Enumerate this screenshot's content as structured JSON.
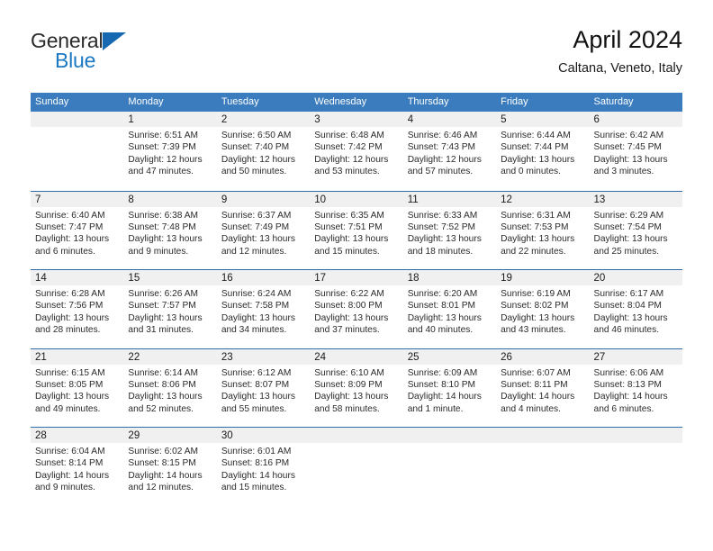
{
  "brand": {
    "name_part1": "General",
    "name_part2": "Blue"
  },
  "header": {
    "month_title": "April 2024",
    "location": "Caltana, Veneto, Italy"
  },
  "colors": {
    "header_blue": "#3a7cbe",
    "week_divider": "#2f6ea8",
    "daynum_band": "#f0f0f0",
    "brand_blue": "#1b79c4"
  },
  "weekdays": [
    "Sunday",
    "Monday",
    "Tuesday",
    "Wednesday",
    "Thursday",
    "Friday",
    "Saturday"
  ],
  "weeks": [
    [
      {
        "day": "",
        "sunrise": "",
        "sunset": "",
        "daylight_line1": "",
        "daylight_line2": "",
        "empty": true
      },
      {
        "day": "1",
        "sunrise": "Sunrise: 6:51 AM",
        "sunset": "Sunset: 7:39 PM",
        "daylight_line1": "Daylight: 12 hours",
        "daylight_line2": "and 47 minutes."
      },
      {
        "day": "2",
        "sunrise": "Sunrise: 6:50 AM",
        "sunset": "Sunset: 7:40 PM",
        "daylight_line1": "Daylight: 12 hours",
        "daylight_line2": "and 50 minutes."
      },
      {
        "day": "3",
        "sunrise": "Sunrise: 6:48 AM",
        "sunset": "Sunset: 7:42 PM",
        "daylight_line1": "Daylight: 12 hours",
        "daylight_line2": "and 53 minutes."
      },
      {
        "day": "4",
        "sunrise": "Sunrise: 6:46 AM",
        "sunset": "Sunset: 7:43 PM",
        "daylight_line1": "Daylight: 12 hours",
        "daylight_line2": "and 57 minutes."
      },
      {
        "day": "5",
        "sunrise": "Sunrise: 6:44 AM",
        "sunset": "Sunset: 7:44 PM",
        "daylight_line1": "Daylight: 13 hours",
        "daylight_line2": "and 0 minutes."
      },
      {
        "day": "6",
        "sunrise": "Sunrise: 6:42 AM",
        "sunset": "Sunset: 7:45 PM",
        "daylight_line1": "Daylight: 13 hours",
        "daylight_line2": "and 3 minutes."
      }
    ],
    [
      {
        "day": "7",
        "sunrise": "Sunrise: 6:40 AM",
        "sunset": "Sunset: 7:47 PM",
        "daylight_line1": "Daylight: 13 hours",
        "daylight_line2": "and 6 minutes."
      },
      {
        "day": "8",
        "sunrise": "Sunrise: 6:38 AM",
        "sunset": "Sunset: 7:48 PM",
        "daylight_line1": "Daylight: 13 hours",
        "daylight_line2": "and 9 minutes."
      },
      {
        "day": "9",
        "sunrise": "Sunrise: 6:37 AM",
        "sunset": "Sunset: 7:49 PM",
        "daylight_line1": "Daylight: 13 hours",
        "daylight_line2": "and 12 minutes."
      },
      {
        "day": "10",
        "sunrise": "Sunrise: 6:35 AM",
        "sunset": "Sunset: 7:51 PM",
        "daylight_line1": "Daylight: 13 hours",
        "daylight_line2": "and 15 minutes."
      },
      {
        "day": "11",
        "sunrise": "Sunrise: 6:33 AM",
        "sunset": "Sunset: 7:52 PM",
        "daylight_line1": "Daylight: 13 hours",
        "daylight_line2": "and 18 minutes."
      },
      {
        "day": "12",
        "sunrise": "Sunrise: 6:31 AM",
        "sunset": "Sunset: 7:53 PM",
        "daylight_line1": "Daylight: 13 hours",
        "daylight_line2": "and 22 minutes."
      },
      {
        "day": "13",
        "sunrise": "Sunrise: 6:29 AM",
        "sunset": "Sunset: 7:54 PM",
        "daylight_line1": "Daylight: 13 hours",
        "daylight_line2": "and 25 minutes."
      }
    ],
    [
      {
        "day": "14",
        "sunrise": "Sunrise: 6:28 AM",
        "sunset": "Sunset: 7:56 PM",
        "daylight_line1": "Daylight: 13 hours",
        "daylight_line2": "and 28 minutes."
      },
      {
        "day": "15",
        "sunrise": "Sunrise: 6:26 AM",
        "sunset": "Sunset: 7:57 PM",
        "daylight_line1": "Daylight: 13 hours",
        "daylight_line2": "and 31 minutes."
      },
      {
        "day": "16",
        "sunrise": "Sunrise: 6:24 AM",
        "sunset": "Sunset: 7:58 PM",
        "daylight_line1": "Daylight: 13 hours",
        "daylight_line2": "and 34 minutes."
      },
      {
        "day": "17",
        "sunrise": "Sunrise: 6:22 AM",
        "sunset": "Sunset: 8:00 PM",
        "daylight_line1": "Daylight: 13 hours",
        "daylight_line2": "and 37 minutes."
      },
      {
        "day": "18",
        "sunrise": "Sunrise: 6:20 AM",
        "sunset": "Sunset: 8:01 PM",
        "daylight_line1": "Daylight: 13 hours",
        "daylight_line2": "and 40 minutes."
      },
      {
        "day": "19",
        "sunrise": "Sunrise: 6:19 AM",
        "sunset": "Sunset: 8:02 PM",
        "daylight_line1": "Daylight: 13 hours",
        "daylight_line2": "and 43 minutes."
      },
      {
        "day": "20",
        "sunrise": "Sunrise: 6:17 AM",
        "sunset": "Sunset: 8:04 PM",
        "daylight_line1": "Daylight: 13 hours",
        "daylight_line2": "and 46 minutes."
      }
    ],
    [
      {
        "day": "21",
        "sunrise": "Sunrise: 6:15 AM",
        "sunset": "Sunset: 8:05 PM",
        "daylight_line1": "Daylight: 13 hours",
        "daylight_line2": "and 49 minutes."
      },
      {
        "day": "22",
        "sunrise": "Sunrise: 6:14 AM",
        "sunset": "Sunset: 8:06 PM",
        "daylight_line1": "Daylight: 13 hours",
        "daylight_line2": "and 52 minutes."
      },
      {
        "day": "23",
        "sunrise": "Sunrise: 6:12 AM",
        "sunset": "Sunset: 8:07 PM",
        "daylight_line1": "Daylight: 13 hours",
        "daylight_line2": "and 55 minutes."
      },
      {
        "day": "24",
        "sunrise": "Sunrise: 6:10 AM",
        "sunset": "Sunset: 8:09 PM",
        "daylight_line1": "Daylight: 13 hours",
        "daylight_line2": "and 58 minutes."
      },
      {
        "day": "25",
        "sunrise": "Sunrise: 6:09 AM",
        "sunset": "Sunset: 8:10 PM",
        "daylight_line1": "Daylight: 14 hours",
        "daylight_line2": "and 1 minute."
      },
      {
        "day": "26",
        "sunrise": "Sunrise: 6:07 AM",
        "sunset": "Sunset: 8:11 PM",
        "daylight_line1": "Daylight: 14 hours",
        "daylight_line2": "and 4 minutes."
      },
      {
        "day": "27",
        "sunrise": "Sunrise: 6:06 AM",
        "sunset": "Sunset: 8:13 PM",
        "daylight_line1": "Daylight: 14 hours",
        "daylight_line2": "and 6 minutes."
      }
    ],
    [
      {
        "day": "28",
        "sunrise": "Sunrise: 6:04 AM",
        "sunset": "Sunset: 8:14 PM",
        "daylight_line1": "Daylight: 14 hours",
        "daylight_line2": "and 9 minutes."
      },
      {
        "day": "29",
        "sunrise": "Sunrise: 6:02 AM",
        "sunset": "Sunset: 8:15 PM",
        "daylight_line1": "Daylight: 14 hours",
        "daylight_line2": "and 12 minutes."
      },
      {
        "day": "30",
        "sunrise": "Sunrise: 6:01 AM",
        "sunset": "Sunset: 8:16 PM",
        "daylight_line1": "Daylight: 14 hours",
        "daylight_line2": "and 15 minutes."
      },
      {
        "day": "",
        "sunrise": "",
        "sunset": "",
        "daylight_line1": "",
        "daylight_line2": "",
        "empty": true
      },
      {
        "day": "",
        "sunrise": "",
        "sunset": "",
        "daylight_line1": "",
        "daylight_line2": "",
        "empty": true
      },
      {
        "day": "",
        "sunrise": "",
        "sunset": "",
        "daylight_line1": "",
        "daylight_line2": "",
        "empty": true
      },
      {
        "day": "",
        "sunrise": "",
        "sunset": "",
        "daylight_line1": "",
        "daylight_line2": "",
        "empty": true
      }
    ]
  ]
}
